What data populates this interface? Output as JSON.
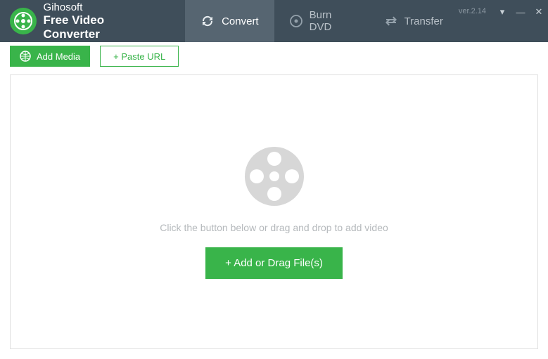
{
  "app": {
    "brand": "Gihosoft",
    "name": "Free Video Converter",
    "version": "ver.2.14"
  },
  "tabs": {
    "convert": "Convert",
    "burn": "Burn DVD",
    "transfer": "Transfer"
  },
  "toolbar": {
    "add_media": "Add Media",
    "paste_url": "+ Paste URL"
  },
  "dropzone": {
    "hint": "Click the button below or drag and drop to add video",
    "add_button": "+ Add or Drag File(s)"
  },
  "window_controls": {
    "menu": "▾",
    "minimize": "—",
    "close": "✕"
  }
}
